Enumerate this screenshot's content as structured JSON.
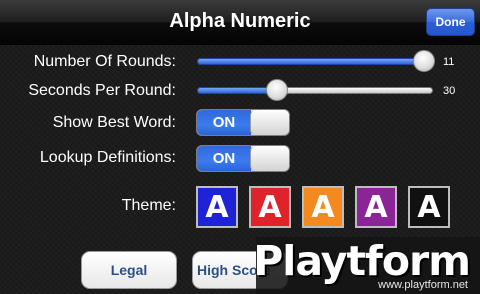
{
  "navbar": {
    "title": "Alpha Numeric",
    "done_label": "Done"
  },
  "settings": {
    "rounds": {
      "label": "Number Of Rounds:",
      "value": "11",
      "fraction": 0.96
    },
    "seconds": {
      "label": "Seconds Per Round:",
      "value": "30",
      "fraction": 0.34
    },
    "best_word": {
      "label": "Show Best Word:",
      "state": "ON"
    },
    "definitions": {
      "label": "Lookup Definitions:",
      "state": "ON"
    },
    "theme": {
      "label": "Theme:",
      "options": [
        {
          "letter": "A",
          "color": "#1f23d6"
        },
        {
          "letter": "A",
          "color": "#e0232a"
        },
        {
          "letter": "A",
          "color": "#f3891f"
        },
        {
          "letter": "A",
          "color": "#8a2497"
        },
        {
          "letter": "A",
          "color": "#111111"
        }
      ]
    }
  },
  "buttons": {
    "legal": "Legal",
    "high_scores": "High Score"
  },
  "watermark": {
    "logo": "Playtform",
    "url": "www.playtform.net"
  }
}
